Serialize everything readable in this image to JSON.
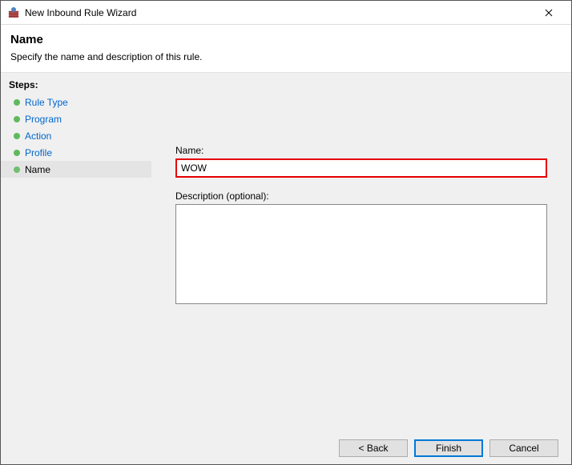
{
  "window": {
    "title": "New Inbound Rule Wizard"
  },
  "header": {
    "title": "Name",
    "description": "Specify the name and description of this rule."
  },
  "sidebar": {
    "stepsLabel": "Steps:",
    "items": [
      {
        "label": "Rule Type"
      },
      {
        "label": "Program"
      },
      {
        "label": "Action"
      },
      {
        "label": "Profile"
      },
      {
        "label": "Name"
      }
    ]
  },
  "form": {
    "nameLabel": "Name:",
    "nameValue": "WOW",
    "descLabel": "Description (optional):",
    "descValue": ""
  },
  "buttons": {
    "back": "< Back",
    "finish": "Finish",
    "cancel": "Cancel"
  }
}
